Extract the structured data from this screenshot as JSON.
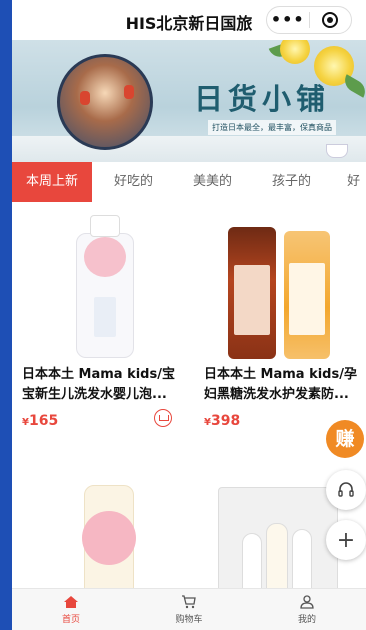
{
  "app": {
    "title": "HIS北京新日国旅",
    "more_label": "•••"
  },
  "banner": {
    "headline": "日货小铺",
    "subline": "打造日本最全，最丰富，保真商品"
  },
  "tabs": [
    {
      "label": "本周上新",
      "active": true
    },
    {
      "label": "好吃的",
      "active": false
    },
    {
      "label": "美美的",
      "active": false
    },
    {
      "label": "孩子的",
      "active": false
    },
    {
      "label": "好",
      "active": false
    }
  ],
  "products": [
    {
      "name": "日本本土 Mama kids/宝宝新生儿洗发水婴儿泡...",
      "currency": "¥",
      "price": "165"
    },
    {
      "name": "日本本土 Mama kids/孕妇黑糖洗发水护发素防...",
      "currency": "¥",
      "price": "398"
    }
  ],
  "floating": {
    "earn_label": "赚"
  },
  "bottom_nav": [
    {
      "label": "首页",
      "icon": "home-icon",
      "active": true
    },
    {
      "label": "购物车",
      "icon": "cart-icon",
      "active": false
    },
    {
      "label": "我的",
      "icon": "user-icon",
      "active": false
    }
  ],
  "colors": {
    "accent": "#e8473d",
    "earn": "#f08a24",
    "frame": "#1e4fb5"
  }
}
